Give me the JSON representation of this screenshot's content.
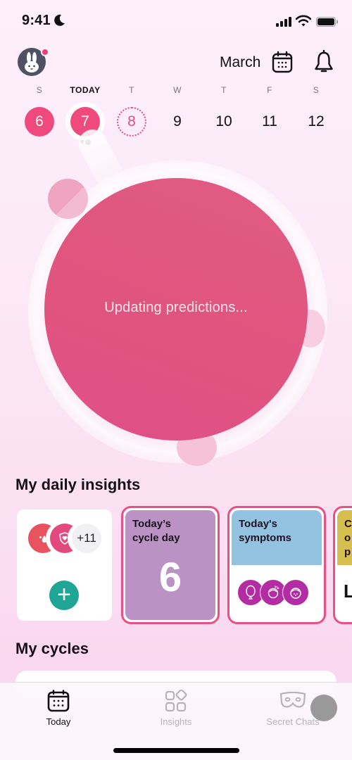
{
  "status_bar": {
    "time": "9:41"
  },
  "header": {
    "month": "March",
    "avatar_has_notification": true
  },
  "week": {
    "days": [
      {
        "letter": "S",
        "number": "6",
        "state": "period"
      },
      {
        "letter": "TODAY",
        "number": "7",
        "state": "period-today",
        "marks": [
          "heart",
          "dot"
        ]
      },
      {
        "letter": "T",
        "number": "8",
        "state": "predicted"
      },
      {
        "letter": "W",
        "number": "9",
        "state": "normal"
      },
      {
        "letter": "T",
        "number": "10",
        "state": "normal"
      },
      {
        "letter": "F",
        "number": "11",
        "state": "normal"
      },
      {
        "letter": "S",
        "number": "12",
        "state": "normal"
      }
    ]
  },
  "cycle_circle": {
    "status": "Updating predictions..."
  },
  "insights": {
    "title": "My daily insights",
    "log_card": {
      "more_count": "+11",
      "add_label": "+"
    },
    "cycle_day_card": {
      "label_line1": "Today’s",
      "label_line2": "cycle day",
      "value": "6"
    },
    "symptoms_card": {
      "label_line1": "Today's",
      "label_line2": "symptoms"
    },
    "partial_card": {
      "label_line1": "C",
      "label_line2": "o",
      "label_line3": "p",
      "big": "L"
    }
  },
  "cycles": {
    "title": "My cycles"
  },
  "tabs": [
    {
      "label": "Today",
      "active": true
    },
    {
      "label": "Insights",
      "active": false
    },
    {
      "label": "Secret Chats",
      "active": false
    }
  ],
  "colors": {
    "period": "#ef4a7d",
    "cycle_circle": "#e0557f",
    "cycle_day_card": "#ba93c4",
    "symptoms_card": "#94c3e2",
    "symptom_icon": "#b42ca3",
    "add_button": "#1fa595"
  }
}
